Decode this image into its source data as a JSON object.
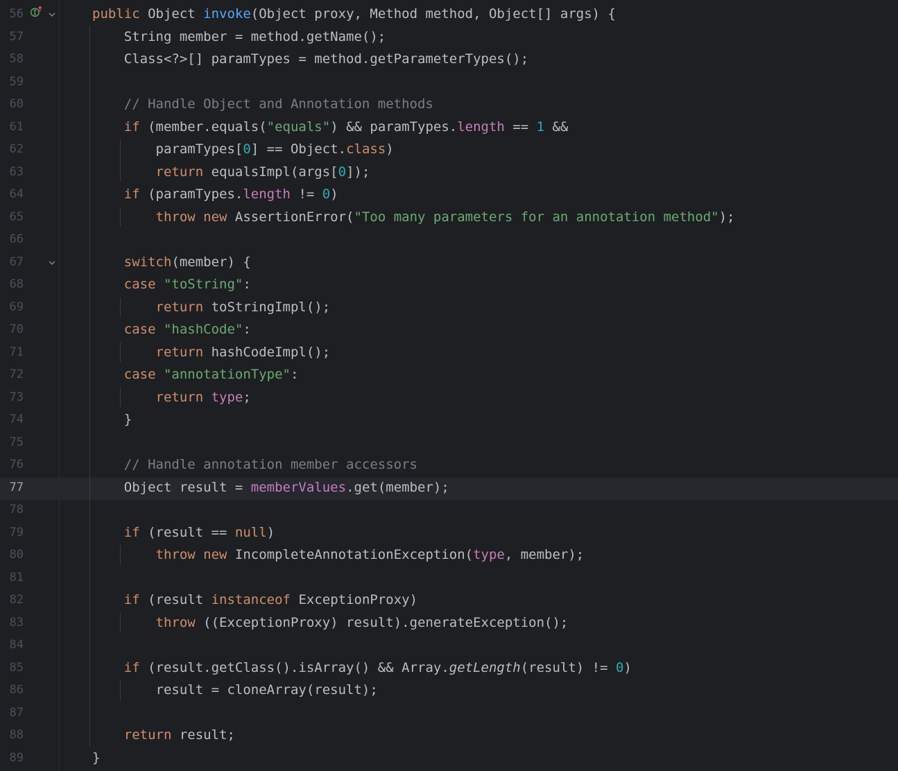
{
  "editor": {
    "current_line": 77,
    "line_numbers": [
      "56",
      "57",
      "58",
      "59",
      "60",
      "61",
      "62",
      "63",
      "64",
      "65",
      "66",
      "67",
      "68",
      "69",
      "70",
      "71",
      "72",
      "73",
      "74",
      "75",
      "76",
      "77",
      "78",
      "79",
      "80",
      "81",
      "82",
      "83",
      "84",
      "85",
      "86",
      "87",
      "88",
      "89"
    ],
    "lines": [
      [
        [
          "kw",
          "public "
        ],
        [
          "",
          "Object "
        ],
        [
          "fn",
          "invoke"
        ],
        [
          "",
          "(Object proxy, Method method, Object[] args) {"
        ]
      ],
      [
        [
          "",
          "    String member = method.getName();"
        ]
      ],
      [
        [
          "",
          "    Class<?>[] paramTypes = method.getParameterTypes();"
        ]
      ],
      [],
      [
        [
          "cmt",
          "    // Handle Object and Annotation methods"
        ]
      ],
      [
        [
          "kw",
          "    if "
        ],
        [
          "",
          "(member.equals("
        ],
        [
          "str",
          "\"equals\""
        ],
        [
          "",
          ") && paramTypes."
        ],
        [
          "fld",
          "length"
        ],
        [
          "",
          " == "
        ],
        [
          "num",
          "1"
        ],
        [
          "",
          " &&"
        ]
      ],
      [
        [
          "",
          "        paramTypes["
        ],
        [
          "num",
          "0"
        ],
        [
          "",
          "] == Object."
        ],
        [
          "kw",
          "class"
        ],
        [
          "",
          ")"
        ]
      ],
      [
        [
          "kw",
          "        return "
        ],
        [
          "",
          "equalsImpl(args["
        ],
        [
          "num",
          "0"
        ],
        [
          "",
          "]);"
        ]
      ],
      [
        [
          "kw",
          "    if "
        ],
        [
          "",
          "(paramTypes."
        ],
        [
          "fld",
          "length"
        ],
        [
          "",
          " != "
        ],
        [
          "num",
          "0"
        ],
        [
          "",
          ")"
        ]
      ],
      [
        [
          "kw",
          "        throw new "
        ],
        [
          "",
          "AssertionError("
        ],
        [
          "str",
          "\"Too many parameters for an annotation method\""
        ],
        [
          "",
          ");"
        ]
      ],
      [],
      [
        [
          "kw",
          "    switch"
        ],
        [
          "",
          "(member) {"
        ]
      ],
      [
        [
          "kw",
          "    case "
        ],
        [
          "str",
          "\"toString\""
        ],
        [
          "",
          ":"
        ]
      ],
      [
        [
          "kw",
          "        return "
        ],
        [
          "",
          "toStringImpl();"
        ]
      ],
      [
        [
          "kw",
          "    case "
        ],
        [
          "str",
          "\"hashCode\""
        ],
        [
          "",
          ":"
        ]
      ],
      [
        [
          "kw",
          "        return "
        ],
        [
          "",
          "hashCodeImpl();"
        ]
      ],
      [
        [
          "kw",
          "    case "
        ],
        [
          "str",
          "\"annotationType\""
        ],
        [
          "",
          ":"
        ]
      ],
      [
        [
          "kw",
          "        return "
        ],
        [
          "fld",
          "type"
        ],
        [
          "",
          ";"
        ]
      ],
      [
        [
          "",
          "    }"
        ]
      ],
      [],
      [
        [
          "cmt",
          "    // Handle annotation member accessors"
        ]
      ],
      [
        [
          "",
          "    Object result = "
        ],
        [
          "fld",
          "memberValues"
        ],
        [
          "",
          ".get(member);"
        ]
      ],
      [],
      [
        [
          "kw",
          "    if "
        ],
        [
          "",
          "(result == "
        ],
        [
          "kw",
          "null"
        ],
        [
          "",
          ")"
        ]
      ],
      [
        [
          "kw",
          "        throw new "
        ],
        [
          "",
          "IncompleteAnnotationException("
        ],
        [
          "fld",
          "type"
        ],
        [
          "",
          ", member);"
        ]
      ],
      [],
      [
        [
          "kw",
          "    if "
        ],
        [
          "",
          "(result "
        ],
        [
          "kw",
          "instanceof "
        ],
        [
          "",
          "ExceptionProxy)"
        ]
      ],
      [
        [
          "kw",
          "        throw "
        ],
        [
          "",
          "((ExceptionProxy) result).generateException();"
        ]
      ],
      [],
      [
        [
          "kw",
          "    if "
        ],
        [
          "",
          "(result.getClass().isArray() && Array."
        ],
        [
          "it",
          "getLength"
        ],
        [
          "",
          "(result) != "
        ],
        [
          "num",
          "0"
        ],
        [
          "",
          ")"
        ]
      ],
      [
        [
          "",
          "        result = cloneArray(result);"
        ]
      ],
      [],
      [
        [
          "kw",
          "    return "
        ],
        [
          "",
          "result;"
        ]
      ],
      [
        [
          "",
          "}"
        ]
      ]
    ]
  },
  "gutter_icons": {
    "implements_icon": "implements-up-arrow-icon",
    "fold_icon": "chevron-down-icon"
  },
  "colors": {
    "background": "#1e1f22",
    "keyword": "#cf8e6d",
    "method": "#56a8f5",
    "string": "#6aab73",
    "number": "#2aacb8",
    "field": "#c77dbb",
    "comment": "#7a7e85",
    "text": "#bcbec4"
  }
}
